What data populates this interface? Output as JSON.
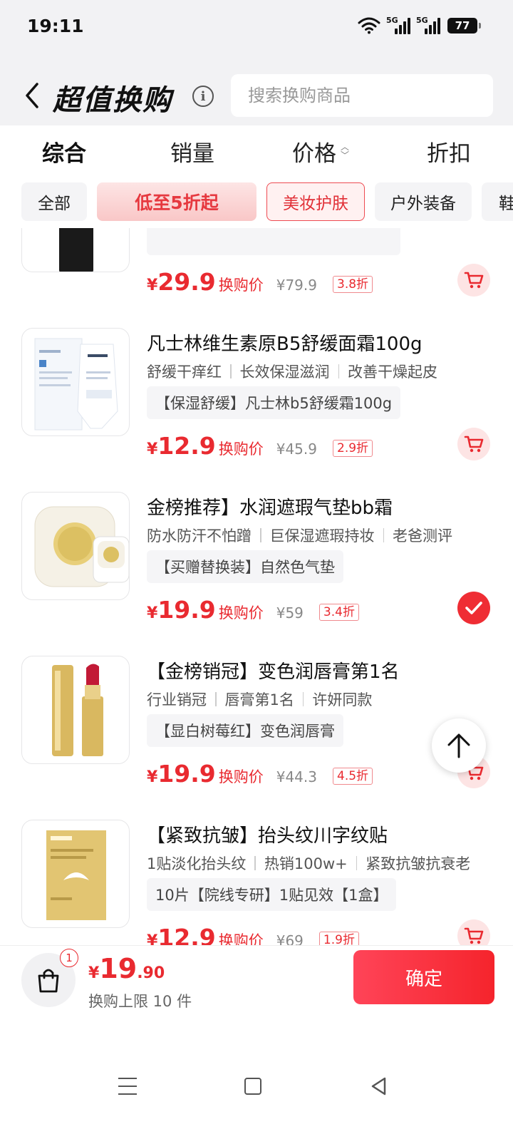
{
  "status_bar": {
    "time": "19:11",
    "signal1_label": "5G",
    "signal2_label": "5G",
    "battery": "77"
  },
  "header": {
    "title": "超值换购",
    "search_placeholder": "搜索换购商品"
  },
  "sort_tabs": [
    {
      "label": "综合",
      "active": true
    },
    {
      "label": "销量",
      "active": false
    },
    {
      "label": "价格",
      "active": false,
      "sortable": true
    },
    {
      "label": "折扣",
      "active": false
    }
  ],
  "filter_chips": [
    {
      "label": "全部",
      "state": "default"
    },
    {
      "label": "低至5折起",
      "state": "promo"
    },
    {
      "label": "美妆护肤",
      "state": "selected"
    },
    {
      "label": "户外装备",
      "state": "default"
    },
    {
      "label": "鞋",
      "state": "default"
    }
  ],
  "products": [
    {
      "title": "",
      "tags": [],
      "spec": "",
      "price": "29.9",
      "price_label": "换购价",
      "original_price": "¥79.9",
      "discount": "3.8折",
      "action": "cart"
    },
    {
      "title": "凡士林维生素原B5舒缓面霜100g",
      "tags": [
        "舒缓干痒红",
        "长效保湿滋润",
        "改善干燥起皮"
      ],
      "spec": "【保湿舒缓】凡士林b5舒缓霜100g",
      "price": "12.9",
      "price_label": "换购价",
      "original_price": "¥45.9",
      "discount": "2.9折",
      "action": "cart"
    },
    {
      "title": "金榜推荐】水润遮瑕气垫bb霜",
      "tags": [
        "防水防汗不怕蹭",
        "巨保湿遮瑕持妆",
        "老爸测评"
      ],
      "spec": "【买赠替换装】自然色气垫",
      "price": "19.9",
      "price_label": "换购价",
      "original_price": "¥59",
      "discount": "3.4折",
      "action": "selected"
    },
    {
      "title": "【金榜销冠】变色润唇膏第1名",
      "tags": [
        "行业销冠",
        "唇膏第1名",
        "许妍同款"
      ],
      "spec": "【显白树莓红】变色润唇膏",
      "price": "19.9",
      "price_label": "换购价",
      "original_price": "¥44.3",
      "discount": "4.5折",
      "action": "cart"
    },
    {
      "title": "【紧致抗皱】抬头纹川字纹贴",
      "tags": [
        "1贴淡化抬头纹",
        "热销100w+",
        "紧致抗皱抗衰老"
      ],
      "spec": "10片【院线专研】1贴见效【1盒】",
      "price": "12.9",
      "price_label": "换购价",
      "original_price": "¥69",
      "discount": "1.9折",
      "action": "cart"
    }
  ],
  "bottom_bar": {
    "cart_count": "1",
    "total_yen": "¥",
    "total_int": "19",
    "total_dec": ".90",
    "limit_text": "换购上限 10 件",
    "confirm_label": "确定"
  },
  "colors": {
    "accent_red": "#e92a30",
    "header_bg": "#f2f2f4"
  }
}
